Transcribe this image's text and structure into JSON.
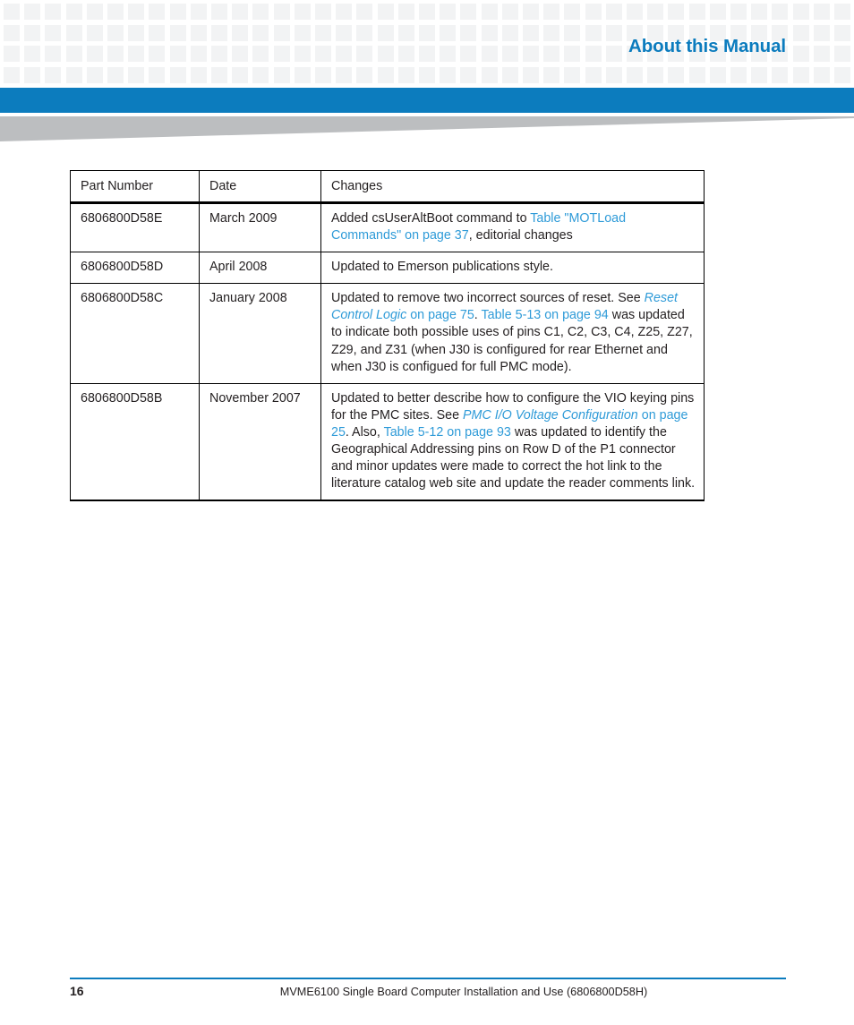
{
  "header": {
    "title": "About this Manual",
    "accent_color": "#0c7cbe",
    "grid_square_color": "#f2f3f4",
    "swoosh_color": "#bcbec0"
  },
  "table": {
    "columns": [
      "Part Number",
      "Date",
      "Changes"
    ],
    "rows": [
      {
        "part_number": "6806800D58E",
        "date": "March 2009",
        "changes_segments": [
          {
            "text": "Added csUserAltBoot command to ",
            "style": "plain"
          },
          {
            "text": "Table \"MOTLoad Commands\" on page 37",
            "style": "link"
          },
          {
            "text": ", editorial changes",
            "style": "plain"
          }
        ]
      },
      {
        "part_number": "6806800D58D",
        "date": "April 2008",
        "changes_segments": [
          {
            "text": "Updated to Emerson publications style.",
            "style": "plain"
          }
        ]
      },
      {
        "part_number": "6806800D58C",
        "date": "January 2008",
        "changes_segments": [
          {
            "text": "Updated to remove two incorrect sources of reset. See ",
            "style": "plain"
          },
          {
            "text": "Reset Control Logic",
            "style": "link-italic"
          },
          {
            "text": " on page 75",
            "style": "link"
          },
          {
            "text": ". ",
            "style": "plain"
          },
          {
            "text": "Table 5-13 on page 94",
            "style": "link"
          },
          {
            "text": " was updated to indicate both possible uses of pins C1, C2, C3, C4, Z25, Z27, Z29, and Z31 (when J30 is configured for rear Ethernet and when J30 is configued for full PMC mode).",
            "style": "plain"
          }
        ]
      },
      {
        "part_number": "6806800D58B",
        "date": "November 2007",
        "changes_segments": [
          {
            "text": "Updated to better describe how to configure the VIO keying pins for the PMC sites. See ",
            "style": "plain"
          },
          {
            "text": "PMC I/O Voltage Configuration",
            "style": "link-italic"
          },
          {
            "text": " on page 25",
            "style": "link"
          },
          {
            "text": ". Also, ",
            "style": "plain"
          },
          {
            "text": "Table 5-12 on page 93",
            "style": "link"
          },
          {
            "text": " was updated to identify the Geographical Addressing pins on Row D of the P1 connector and minor updates were made to correct the hot link to the literature catalog web site and update the reader comments link.",
            "style": "plain"
          }
        ]
      }
    ]
  },
  "footer": {
    "page_number": "16",
    "document_title": "MVME6100 Single Board Computer Installation and Use (6806800D58H)"
  }
}
